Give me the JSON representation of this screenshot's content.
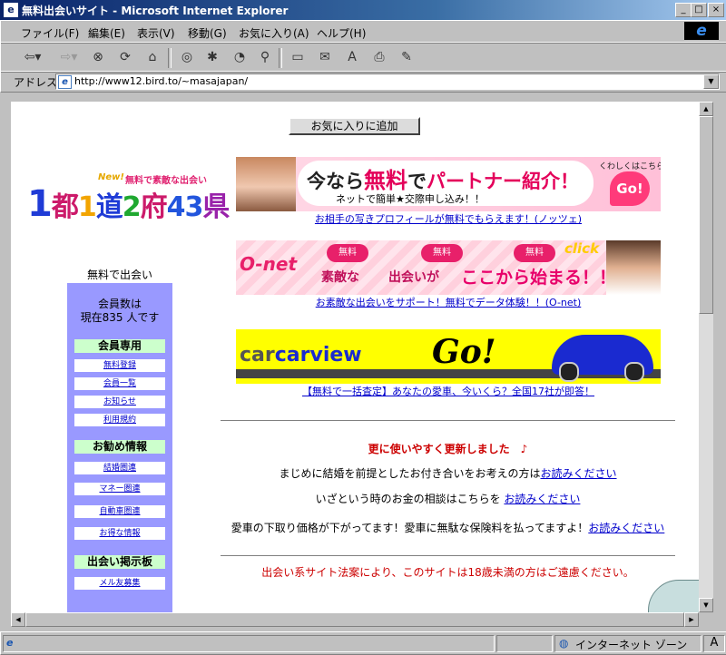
{
  "window": {
    "title": "無料出会いサイト - Microsoft Internet Explorer",
    "controls": {
      "minimize": "_",
      "maximize": "□",
      "close": "×"
    }
  },
  "menu": [
    "ファイル(F)",
    "編集(E)",
    "表示(V)",
    "移動(G)",
    "お気に入り(A)",
    "ヘルプ(H)"
  ],
  "address": {
    "label": "アドレス",
    "url": "http://www12.bird.to/~masajapan/"
  },
  "page": {
    "favorite_button": "お気に入りに追加",
    "logo": {
      "new": "New!",
      "tagline": "無料で素敵な出会い",
      "title_parts": [
        "1",
        "都",
        "1",
        "道",
        "2",
        "府",
        "43",
        "県"
      ],
      "title_colors": [
        "#1f3bd6",
        "#cc1a6a",
        "#f2a400",
        "#1f3bd6",
        "#1fa830",
        "#cc1a6a",
        "#2255dd",
        "#9922aa"
      ]
    },
    "sidebar": {
      "heading": "無料で出会い",
      "members_line1": "会員数は",
      "members_line2": "現在835 人です",
      "sections": [
        {
          "title": "会員専用",
          "links": [
            "無料登録",
            "会員一覧",
            "お知らせ",
            "利用規約"
          ]
        },
        {
          "title": "お勧め情報",
          "links": [
            "結婚圏連",
            "マネー圏連",
            "自動車圏連",
            "お得な情報"
          ]
        },
        {
          "title": "出会い掲示板",
          "links": [
            "メル友募集"
          ]
        }
      ]
    },
    "banners": [
      {
        "main_a": "今なら",
        "main_b": "無料",
        "main_c": "で",
        "main_d": "パートナー紹介！",
        "sub": "ネットで簡単★交際申し込み！！",
        "corner": "くわしくはこちら",
        "go": "Go!",
        "caption": "お相手の写きプロフィールが無料でもらえます！(ノッツェ)"
      },
      {
        "brand": "O-net",
        "free": "無料",
        "w1": "素敵な",
        "w2": "出会いが",
        "w3": "ここから始まる！！",
        "click": "click",
        "caption": "お素敵な出会いをサポート！無料でデータ体験！！(O-net)"
      },
      {
        "brand_a": "car",
        "brand_b": "carview",
        "go": "Go!",
        "caption": "【無料で一括査定】あなたの愛車、今いくら？全国17社が即答！"
      }
    ],
    "update_notice": "更に使いやすく更新しました　♪",
    "lines": [
      {
        "text": "まじめに結婚を前提としたお付き合いをお考えの方は",
        "link": "お読みください"
      },
      {
        "text": "いざという時のお金の相談はこちらを ",
        "link": "お読みください"
      },
      {
        "text": "愛車の下取り価格が下がってます！愛車に無駄な保険料を払ってますよ！",
        "link": "お読みください"
      }
    ],
    "legal_notice": "出会い系サイト法案により、このサイトは18歳未満の方はご遠慮ください。"
  },
  "status": {
    "zone": "インターネット ゾーン",
    "ime": "A"
  },
  "colors": {
    "title_gradient_start": "#0a246a",
    "sidebar_bg": "#9999ff",
    "section_header_bg": "#ccffcc",
    "link": "#0000cc",
    "notice_red": "#cc0000"
  }
}
